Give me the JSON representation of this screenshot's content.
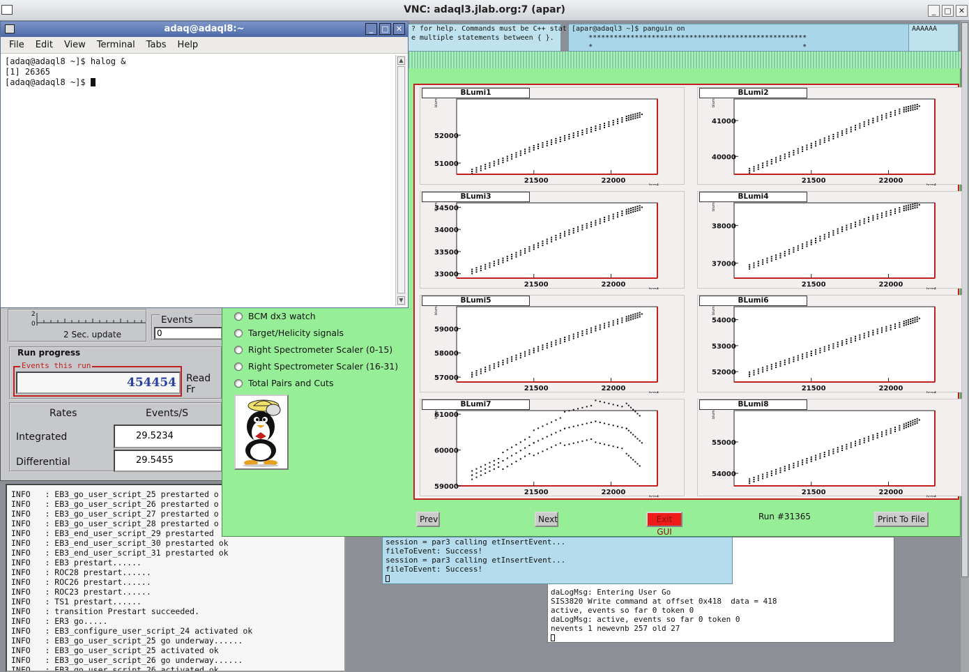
{
  "vnc": {
    "title": "VNC: adaql3.jlab.org:7 (apar)"
  },
  "terminal": {
    "title": "adaq@adaql8:~",
    "menu": [
      "File",
      "Edit",
      "View",
      "Terminal",
      "Tabs",
      "Help"
    ],
    "lines": [
      "[adaq@adaql8 ~]$ halog &",
      "[1] 26365",
      "[adaq@adaql8 ~]$ "
    ]
  },
  "cyan_top1": {
    "lines": [
      "? for help. Commands must be C++ stat",
      "e multiple statements between { }."
    ]
  },
  "cyan_top2": {
    "lines": [
      "[apar@adaql3 ~]$ panguin on",
      "    ****************************************************",
      "    *                                                  *"
    ]
  },
  "cyan_top3": {
    "lines": [
      "",
      "AAAAAA"
    ]
  },
  "daq": {
    "update_label": "2 Sec. update",
    "events_label": "Events",
    "events_value": "0",
    "run_progress_label": "Run progress",
    "events_this_run_label": "Events this run",
    "events_this_run_value": "454454",
    "read_from_label": "Read Fr",
    "rates_label": "Rates",
    "events_per_s_label": "Events/S",
    "integrated_label": "Integrated",
    "integrated_value": "29.5234",
    "differential_label": "Differential",
    "differential_value": "29.5455"
  },
  "log": {
    "lines": [
      "INFO   : EB3_go_user_script_25 prestarted o",
      "INFO   : EB3_go_user_script_26 prestarted o",
      "INFO   : EB3_go_user_script_27 prestarted o",
      "INFO   : EB3_go_user_script_28 prestarted o",
      "INFO   : EB3_end_user_script_29 prestarted",
      "INFO   : EB3_end_user_script_30 prestarted ok",
      "INFO   : EB3_end_user_script_31 prestarted ok",
      "INFO   : EB3 prestart......",
      "INFO   : ROC28 prestart......",
      "INFO   : ROC26 prestart......",
      "INFO   : ROC23 prestart......",
      "INFO   : TS1 prestart......",
      "INFO   : transition Prestart succeeded.",
      "INFO   : ER3 go.....",
      "INFO   : EB3_configure_user_script_24 activated ok",
      "INFO   : EB3_go_user_script_25 go underway......",
      "INFO   : EB3_go_user_script_25 activated ok",
      "INFO   : EB3_go_user_script_26 go underway......",
      "INFO   : EB3_go_user_script_26 activated ok"
    ]
  },
  "panguin": {
    "radio_options": [
      "BCM dx3 watch",
      "Target/Helicity signals",
      "Right Spectrometer Scaler (0-15)",
      "Right Spectrometer Scaler (16-31)",
      "Total Pairs and Cuts"
    ],
    "prev_label": "Prev",
    "next_label": "Next",
    "exit_label": "Exit GUI",
    "run_label": "Run #31365",
    "print_label": "Print To File"
  },
  "cyan_mid": {
    "lines": [
      "session = par3 calling etInsertEvent...",
      "fileToEvent: Success!",
      "session = par3 calling etInsertEvent...",
      "fileToEvent: Success!"
    ]
  },
  "white_term": {
    "lines": [
      "daLogMsg: Entering User Go",
      "SIS3820 Write command at offset 0x418  data = 418",
      "active, events so far 0 token 0",
      "daLogMsg: active, events so far 0 token 0",
      "nevents 1 newevnb 257 old 27"
    ]
  },
  "chart_data": [
    {
      "type": "scatter",
      "title": "BLumi1",
      "xlabel": "bcm4",
      "ylabel": "blumi",
      "xlim": [
        21000,
        22300
      ],
      "ylim": [
        50600,
        53300
      ],
      "xticks": [
        21500,
        22000
      ],
      "yticks": [
        51000,
        52000
      ],
      "x": [
        21100,
        21300,
        21500,
        21700,
        21900,
        22100,
        22200
      ],
      "y": [
        50700,
        51100,
        51550,
        51900,
        52250,
        52600,
        52750
      ]
    },
    {
      "type": "scatter",
      "title": "BLumi2",
      "xlabel": "bcm4",
      "ylabel": "blumi",
      "xlim": [
        21000,
        22300
      ],
      "ylim": [
        39500,
        41600
      ],
      "xticks": [
        21500,
        22000
      ],
      "yticks": [
        40000,
        41000
      ],
      "x": [
        21100,
        21300,
        21500,
        21700,
        21900,
        22100,
        22200
      ],
      "y": [
        39600,
        39950,
        40300,
        40650,
        41000,
        41300,
        41400
      ]
    },
    {
      "type": "scatter",
      "title": "BLumi3",
      "xlabel": "bcm4",
      "ylabel": "blumi",
      "xlim": [
        21000,
        22300
      ],
      "ylim": [
        32900,
        34600
      ],
      "xticks": [
        21500,
        22000
      ],
      "yticks": [
        33000,
        33500,
        34000,
        34500
      ],
      "x": [
        21100,
        21300,
        21500,
        21700,
        21900,
        22100,
        22200
      ],
      "y": [
        33050,
        33300,
        33600,
        33900,
        34150,
        34400,
        34500
      ]
    },
    {
      "type": "scatter",
      "title": "BLumi4",
      "xlabel": "bcm4",
      "ylabel": "blumi",
      "xlim": [
        21000,
        22300
      ],
      "ylim": [
        36600,
        38600
      ],
      "xticks": [
        21500,
        22000
      ],
      "yticks": [
        37000,
        38000
      ],
      "x": [
        21100,
        21300,
        21500,
        21700,
        21900,
        22100,
        22200
      ],
      "y": [
        36900,
        37200,
        37550,
        37900,
        38200,
        38450,
        38550
      ]
    },
    {
      "type": "scatter",
      "title": "BLumi5",
      "xlabel": "bcm4",
      "ylabel": "blumi",
      "xlim": [
        21000,
        22300
      ],
      "ylim": [
        56800,
        59900
      ],
      "xticks": [
        21500,
        22000
      ],
      "yticks": [
        57000,
        58000,
        59000
      ],
      "x": [
        21100,
        21300,
        21500,
        21700,
        21900,
        22100,
        22200
      ],
      "y": [
        57100,
        57600,
        58100,
        58550,
        59000,
        59400,
        59600
      ]
    },
    {
      "type": "scatter",
      "title": "BLumi6",
      "xlabel": "bcm4",
      "ylabel": "blumi",
      "xlim": [
        21000,
        22300
      ],
      "ylim": [
        51600,
        54500
      ],
      "xticks": [
        21500,
        22000
      ],
      "yticks": [
        52000,
        53000,
        54000
      ],
      "x": [
        21100,
        21300,
        21500,
        21700,
        21900,
        22100,
        22200
      ],
      "y": [
        51900,
        52300,
        52700,
        53100,
        53500,
        53850,
        54050
      ]
    },
    {
      "type": "scatter",
      "title": "BLumi7",
      "xlabel": "bcm4",
      "ylabel": "blumi",
      "xlim": [
        21000,
        22300
      ],
      "ylim": [
        59000,
        61100
      ],
      "xticks": [
        21500,
        22000
      ],
      "yticks": [
        59000,
        60000,
        61000
      ],
      "x": [
        21100,
        21300,
        21500,
        21700,
        21900,
        22100,
        22200
      ],
      "y": [
        59300,
        59700,
        60200,
        60600,
        60800,
        60600,
        60200
      ]
    },
    {
      "type": "scatter",
      "title": "BLumi8",
      "xlabel": "bcm4",
      "ylabel": "blumi",
      "xlim": [
        21000,
        22300
      ],
      "ylim": [
        53600,
        56000
      ],
      "xticks": [
        21500,
        22000
      ],
      "yticks": [
        54000,
        55000
      ],
      "x": [
        21100,
        21300,
        21500,
        21700,
        21900,
        22100,
        22200
      ],
      "y": [
        53750,
        54100,
        54450,
        54800,
        55150,
        55500,
        55700
      ]
    }
  ]
}
